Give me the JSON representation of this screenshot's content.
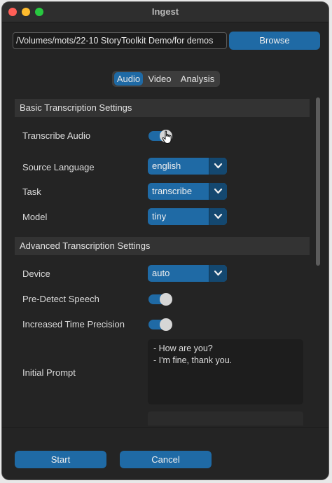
{
  "window": {
    "title": "Ingest"
  },
  "path_field": {
    "value": "/Volumes/mots/22-10 StoryToolkit Demo/for demos"
  },
  "browse_button": {
    "label": "Browse"
  },
  "tabs": [
    {
      "label": "Audio",
      "selected": true
    },
    {
      "label": "Video",
      "selected": false
    },
    {
      "label": "Analysis",
      "selected": false
    }
  ],
  "basic_section": {
    "header": "Basic Transcription Settings",
    "transcribe_audio": {
      "label": "Transcribe Audio",
      "on": true
    },
    "source_language": {
      "label": "Source Language",
      "value": "english"
    },
    "task": {
      "label": "Task",
      "value": "transcribe"
    },
    "model": {
      "label": "Model",
      "value": "tiny"
    }
  },
  "advanced_section": {
    "header": "Advanced Transcription Settings",
    "device": {
      "label": "Device",
      "value": "auto"
    },
    "pre_detect_speech": {
      "label": "Pre-Detect Speech",
      "on": true
    },
    "increased_time_precision": {
      "label": "Increased Time Precision",
      "on": true
    },
    "initial_prompt": {
      "label": "Initial Prompt",
      "lines": [
        "- How are you?",
        "- I'm fine, thank you."
      ]
    }
  },
  "footer": {
    "start_label": "Start",
    "cancel_label": "Cancel"
  },
  "colors": {
    "accent": "#1f6aa5",
    "accent_dark": "#144870",
    "window_bg": "#242424",
    "section_bg": "#333333"
  },
  "icons": {
    "dropdown": "chevron-down-icon",
    "cursor": "hand-pointer-icon"
  }
}
